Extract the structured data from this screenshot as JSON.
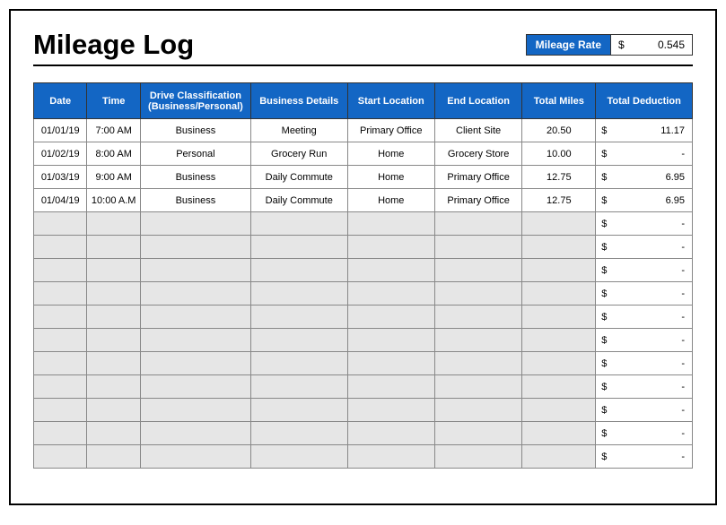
{
  "title": "Mileage Log",
  "rate": {
    "label": "Mileage Rate",
    "currency": "$",
    "value": "0.545"
  },
  "headers": {
    "date": "Date",
    "time": "Time",
    "classification": "Drive Classification (Business/Personal)",
    "details": "Business Details",
    "start": "Start Location",
    "end": "End Location",
    "miles": "Total Miles",
    "deduction": "Total Deduction"
  },
  "rows": [
    {
      "date": "01/01/19",
      "time": "7:00 AM",
      "classification": "Business",
      "details": "Meeting",
      "start": "Primary Office",
      "end": "Client Site",
      "miles": "20.50",
      "deduction_currency": "$",
      "deduction": "11.17"
    },
    {
      "date": "01/02/19",
      "time": "8:00 AM",
      "classification": "Personal",
      "details": "Grocery Run",
      "start": "Home",
      "end": "Grocery Store",
      "miles": "10.00",
      "deduction_currency": "$",
      "deduction": "-"
    },
    {
      "date": "01/03/19",
      "time": "9:00 AM",
      "classification": "Business",
      "details": "Daily Commute",
      "start": "Home",
      "end": "Primary Office",
      "miles": "12.75",
      "deduction_currency": "$",
      "deduction": "6.95"
    },
    {
      "date": "01/04/19",
      "time": "10:00 A.M",
      "classification": "Business",
      "details": "Daily Commute",
      "start": "Home",
      "end": "Primary Office",
      "miles": "12.75",
      "deduction_currency": "$",
      "deduction": "6.95"
    },
    {
      "date": "",
      "time": "",
      "classification": "",
      "details": "",
      "start": "",
      "end": "",
      "miles": "",
      "deduction_currency": "$",
      "deduction": "-"
    },
    {
      "date": "",
      "time": "",
      "classification": "",
      "details": "",
      "start": "",
      "end": "",
      "miles": "",
      "deduction_currency": "$",
      "deduction": "-"
    },
    {
      "date": "",
      "time": "",
      "classification": "",
      "details": "",
      "start": "",
      "end": "",
      "miles": "",
      "deduction_currency": "$",
      "deduction": "-"
    },
    {
      "date": "",
      "time": "",
      "classification": "",
      "details": "",
      "start": "",
      "end": "",
      "miles": "",
      "deduction_currency": "$",
      "deduction": "-"
    },
    {
      "date": "",
      "time": "",
      "classification": "",
      "details": "",
      "start": "",
      "end": "",
      "miles": "",
      "deduction_currency": "$",
      "deduction": "-"
    },
    {
      "date": "",
      "time": "",
      "classification": "",
      "details": "",
      "start": "",
      "end": "",
      "miles": "",
      "deduction_currency": "$",
      "deduction": "-"
    },
    {
      "date": "",
      "time": "",
      "classification": "",
      "details": "",
      "start": "",
      "end": "",
      "miles": "",
      "deduction_currency": "$",
      "deduction": "-"
    },
    {
      "date": "",
      "time": "",
      "classification": "",
      "details": "",
      "start": "",
      "end": "",
      "miles": "",
      "deduction_currency": "$",
      "deduction": "-"
    },
    {
      "date": "",
      "time": "",
      "classification": "",
      "details": "",
      "start": "",
      "end": "",
      "miles": "",
      "deduction_currency": "$",
      "deduction": "-"
    },
    {
      "date": "",
      "time": "",
      "classification": "",
      "details": "",
      "start": "",
      "end": "",
      "miles": "",
      "deduction_currency": "$",
      "deduction": "-"
    },
    {
      "date": "",
      "time": "",
      "classification": "",
      "details": "",
      "start": "",
      "end": "",
      "miles": "",
      "deduction_currency": "$",
      "deduction": "-"
    }
  ]
}
